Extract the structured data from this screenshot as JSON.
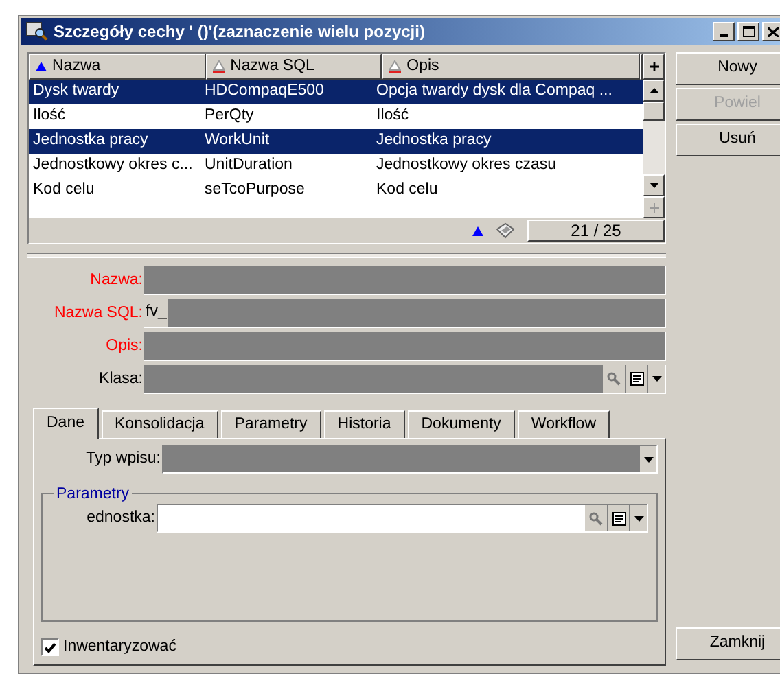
{
  "window": {
    "title": "Szczegóły cechy ' ()'(zaznaczenie wielu pozycji)"
  },
  "table": {
    "columns": [
      {
        "label": "Nazwa",
        "sorted": true
      },
      {
        "label": "Nazwa SQL",
        "sorted": false
      },
      {
        "label": "Opis",
        "sorted": false
      }
    ],
    "rows": [
      {
        "cells": [
          "Dysk twardy",
          "HDCompaqE500",
          "Opcja twardy dysk dla Compaq ..."
        ],
        "selected": true
      },
      {
        "cells": [
          "Ilość",
          "PerQty",
          "Ilość"
        ],
        "selected": false
      },
      {
        "cells": [
          "Jednostka pracy",
          "WorkUnit",
          "Jednostka pracy"
        ],
        "selected": true
      },
      {
        "cells": [
          "Jednostkowy okres c...",
          "UnitDuration",
          "Jednostkowy okres czasu"
        ],
        "selected": false
      },
      {
        "cells": [
          "Kod celu",
          "seTcoPurpose",
          "Kod celu"
        ],
        "selected": false
      }
    ],
    "counter": "21 / 25"
  },
  "buttons": [
    {
      "label": "Nowy",
      "disabled": false
    },
    {
      "label": "Powiel",
      "disabled": true
    },
    {
      "label": "Usuń",
      "disabled": false
    }
  ],
  "fields": [
    {
      "label": "Nazwa:",
      "required": true,
      "kind": "text"
    },
    {
      "label": "Nazwa SQL:",
      "required": true,
      "kind": "text",
      "prefix": "fv_"
    },
    {
      "label": "Opis:",
      "required": true,
      "kind": "text"
    },
    {
      "label": "Klasa:",
      "required": false,
      "kind": "lookup"
    }
  ],
  "tabs": [
    {
      "label": "Dane",
      "selected": true
    },
    {
      "label": "Konsolidacja",
      "selected": false
    },
    {
      "label": "Parametry",
      "selected": false
    },
    {
      "label": "Historia",
      "selected": false
    },
    {
      "label": "Dokumenty",
      "selected": false
    },
    {
      "label": "Workflow",
      "selected": false
    }
  ],
  "entry_type": {
    "label": "Typ wpisu:",
    "disabled": true
  },
  "group": {
    "title": "Parametry",
    "fields": [
      {
        "label": "ednostka:",
        "kind": "lookup",
        "disabled": false
      }
    ]
  },
  "checkbox": {
    "label": "Inwentaryzować",
    "checked": true
  },
  "close_button": {
    "label": "Zamknij"
  }
}
